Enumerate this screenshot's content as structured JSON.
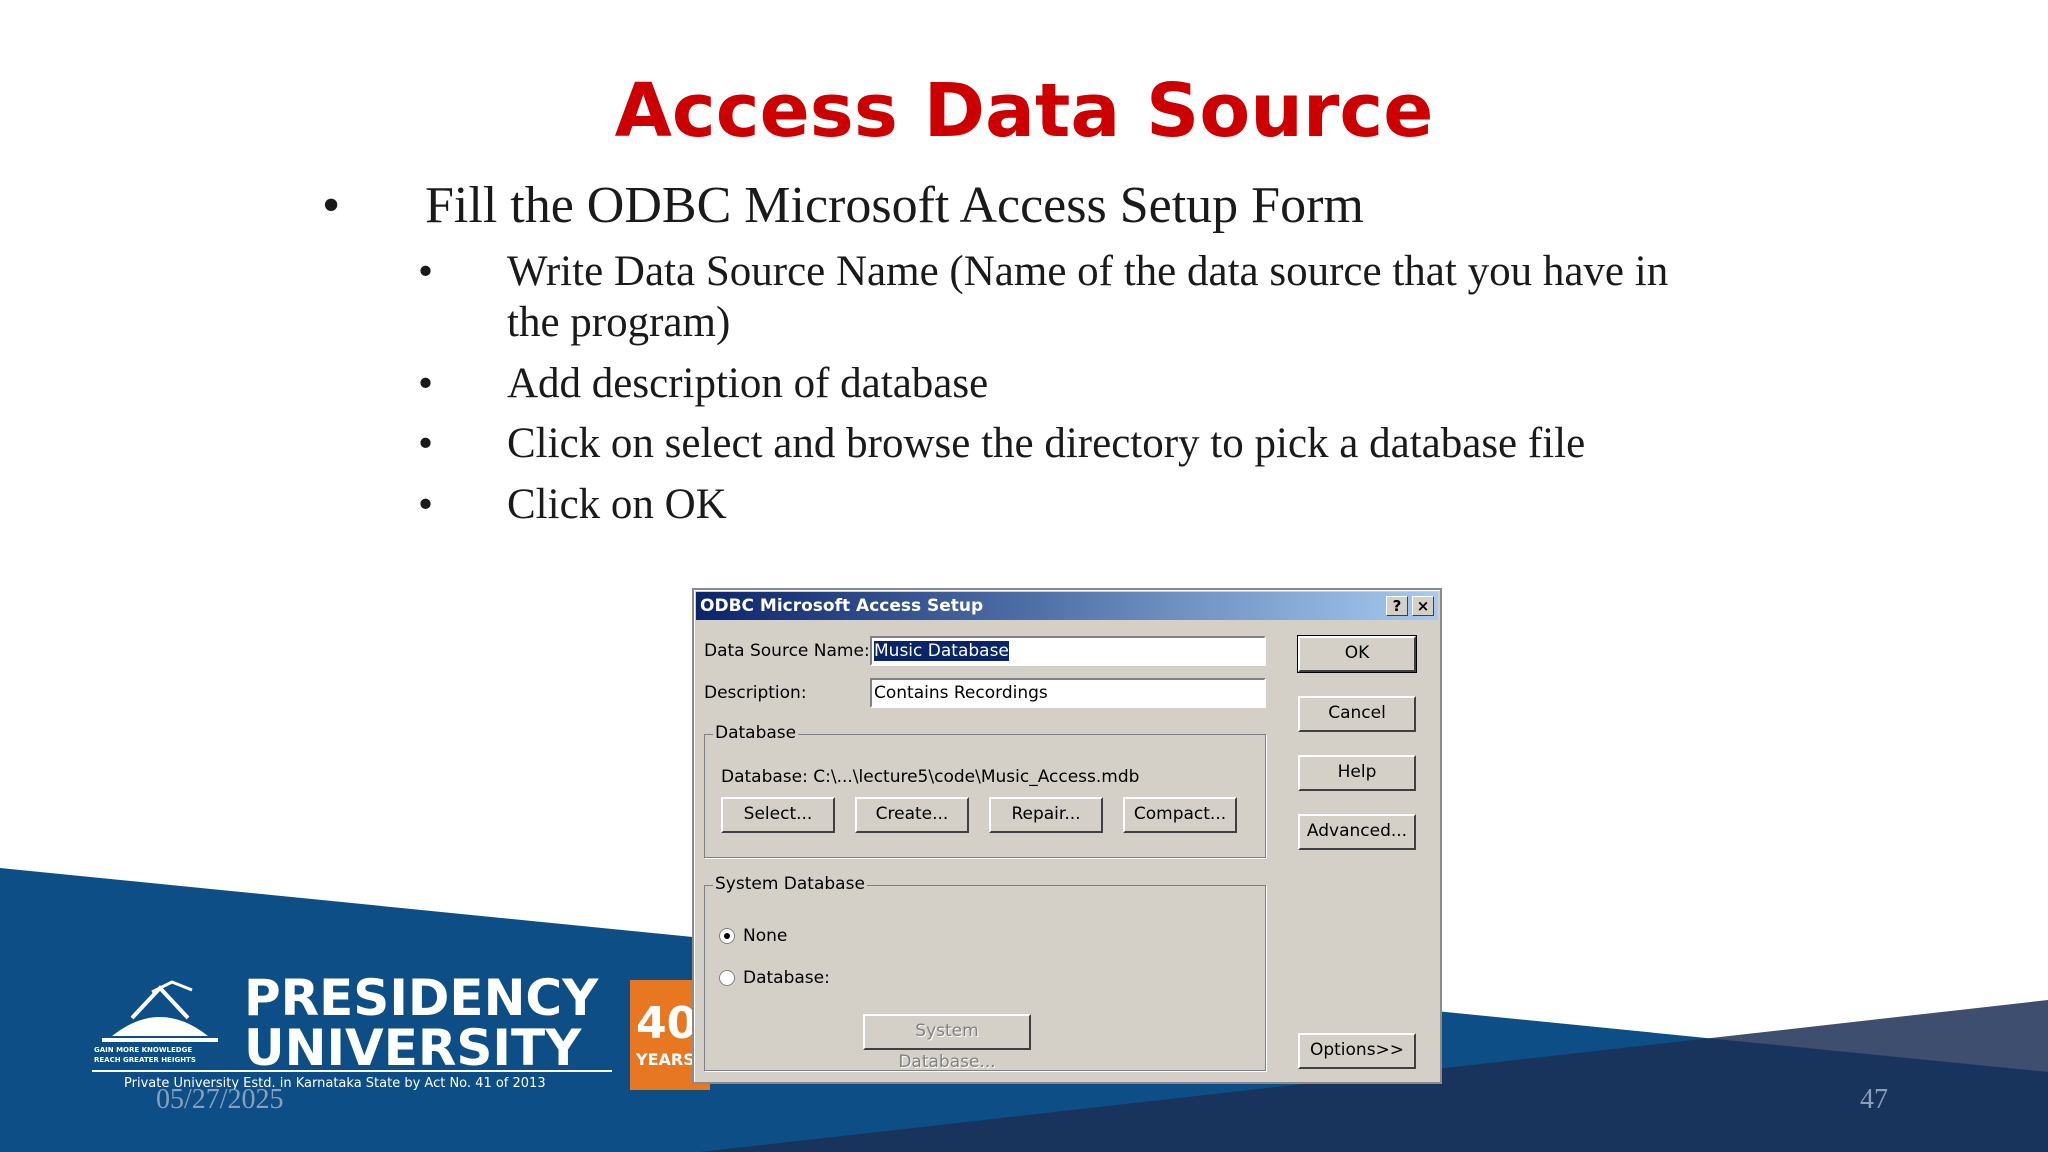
{
  "slide": {
    "title": "Access Data Source",
    "bullets": [
      {
        "text": "Fill the ODBC Microsoft Access Setup Form",
        "level": 1
      },
      {
        "text": "Write Data Source Name (Name of the data source that you have in",
        "level": 2
      },
      {
        "text": "the program)",
        "level": 2
      },
      {
        "text": "Add description of database",
        "level": 2
      },
      {
        "text": "Click on select and browse the directory to pick a database file",
        "level": 2
      },
      {
        "text": "Click on OK",
        "level": 2
      }
    ],
    "bullet_symbol": "•",
    "date": "05/27/2025",
    "page_number": "47",
    "brand_color": "#cc0000",
    "footer_color": "#0d4e86"
  },
  "logo": {
    "line1": "PRESIDENCY",
    "line2": "UNIVERSITY",
    "tagline1": "GAIN MORE KNOWLEDGE",
    "tagline2": "REACH GREATER HEIGHTS",
    "estd": "Private University Estd. in Karnataka State by Act No. 41 of 2013",
    "badge_number": "40",
    "badge_word": "YEARS"
  },
  "dialog": {
    "title": "ODBC Microsoft Access Setup",
    "help_btn": "?",
    "close_btn": "×",
    "dsn_label": "Data Source Name:",
    "dsn_value": "Music Database",
    "desc_label": "Description:",
    "desc_value": "Contains Recordings",
    "ok": "OK",
    "cancel": "Cancel",
    "help": "Help",
    "advanced": "Advanced...",
    "options": "Options>>",
    "database_group": "Database",
    "database_path": "Database:  C:\\...\\lecture5\\code\\Music_Access.mdb",
    "select": "Select...",
    "create": "Create...",
    "repair": "Repair...",
    "compact": "Compact...",
    "system_group": "System Database",
    "radio_none": "None",
    "radio_database": "Database:",
    "system_db_button": "System Database..."
  }
}
